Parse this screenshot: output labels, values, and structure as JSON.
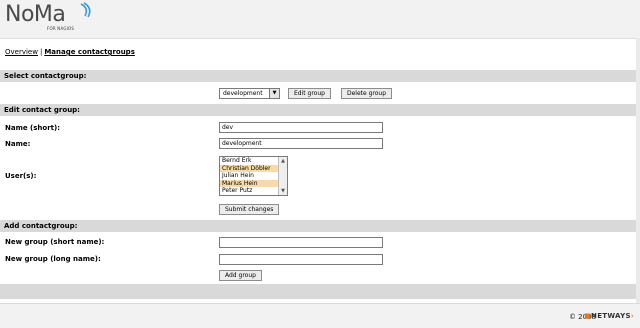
{
  "header": {
    "logo_text": "NoMa",
    "logo_sub": "FOR NAGIOS"
  },
  "nav": {
    "overview": "Overview",
    "separator": "|",
    "manage": "Manage contactgroups"
  },
  "select_section": {
    "title": "Select contactgroup:",
    "selected": "development",
    "edit_button": "Edit group",
    "delete_button": "Delete group"
  },
  "edit_section": {
    "title": "Edit contact group:",
    "name_short_label": "Name (short):",
    "name_short_value": "dev",
    "name_label": "Name:",
    "name_value": "development",
    "users_label": "User(s):",
    "users": [
      {
        "name": "Bernd Erk",
        "selected": false
      },
      {
        "name": "Christian Döbler",
        "selected": true
      },
      {
        "name": "Julian Hein",
        "selected": false
      },
      {
        "name": "Marius Hein",
        "selected": true
      },
      {
        "name": "Peter Putz",
        "selected": false
      }
    ],
    "submit_button": "Submit changes"
  },
  "add_section": {
    "title": "Add contactgroup:",
    "short_label": "New group (short name):",
    "short_value": "",
    "long_label": "New group (long name):",
    "long_value": "",
    "add_button": "Add group"
  },
  "footer": {
    "copyright": "© 2008",
    "brand": "NETWAYS"
  },
  "colors": {
    "section_bg": "#d9d9d9",
    "selected_option_bg": "#f8d9a8",
    "logo_accent": "#3a9ad9"
  }
}
